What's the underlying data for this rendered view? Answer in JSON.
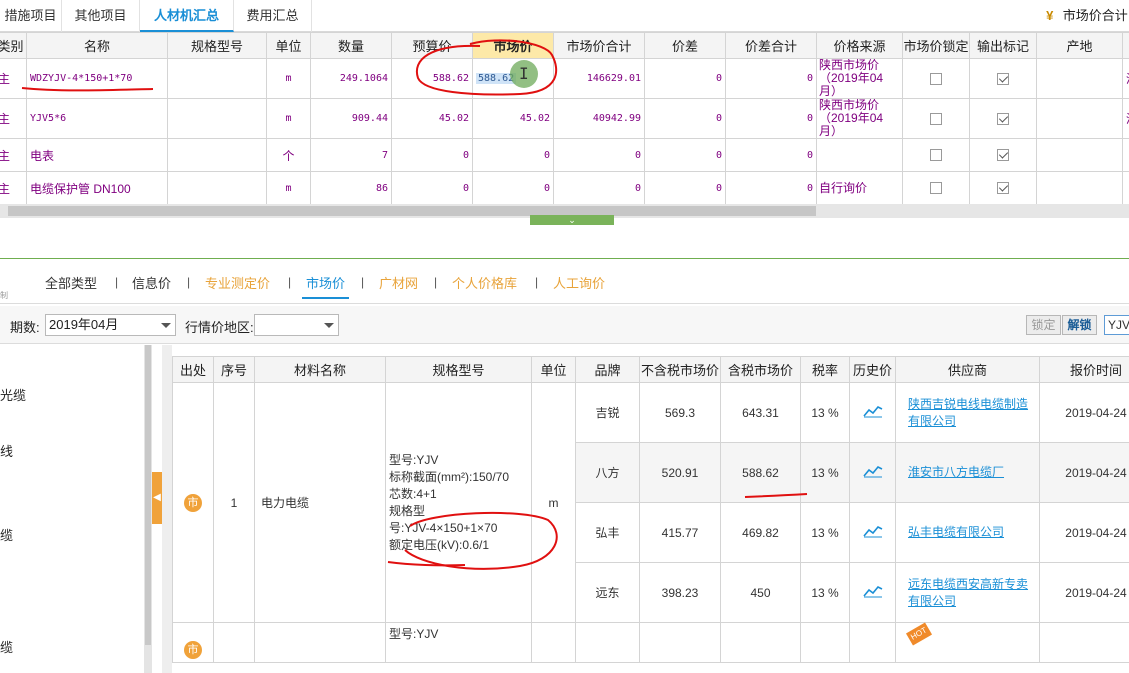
{
  "top_tabs": [
    {
      "label": "措施项目"
    },
    {
      "label": "其他项目"
    },
    {
      "label": "人材机汇总"
    },
    {
      "label": "费用汇总"
    }
  ],
  "summary_label": "市场价合计 :",
  "upper_headers": [
    "类别",
    "名称",
    "规格型号",
    "单位",
    "数量",
    "预算价",
    "市场价",
    "市场价合计",
    "价差",
    "价差合计",
    "价格来源",
    "市场价锁定",
    "输出标记",
    "产地"
  ],
  "upper_rows": [
    {
      "type": "主",
      "name": "WDZYJV-4*150+1*70",
      "spec": "",
      "unit": "m",
      "qty": "249.1064",
      "budget": "588.62",
      "market": "588.62",
      "total": "146629.01",
      "diff": "0",
      "diff_total": "0",
      "source": "陕西市场价（2019年04月）",
      "locked": false,
      "output": true,
      "origin": "",
      "extra": "淮纟"
    },
    {
      "type": "主",
      "name": "YJV5*6",
      "spec": "",
      "unit": "m",
      "qty": "909.44",
      "budget": "45.02",
      "market": "45.02",
      "total": "40942.99",
      "diff": "0",
      "diff_total": "0",
      "source": "陕西市场价（2019年04月）",
      "locked": false,
      "output": true,
      "origin": "",
      "extra": "淮纟"
    },
    {
      "type": "主",
      "name": "电表",
      "spec": "",
      "unit": "个",
      "qty": "7",
      "budget": "0",
      "market": "0",
      "total": "0",
      "diff": "0",
      "diff_total": "0",
      "source": "",
      "locked": false,
      "output": true,
      "origin": "",
      "extra": ""
    },
    {
      "type": "主",
      "name": "电缆保护管 DN100",
      "spec": "",
      "unit": "m",
      "qty": "86",
      "budget": "0",
      "market": "0",
      "total": "0",
      "diff": "0",
      "diff_total": "0",
      "source": "自行询价",
      "locked": false,
      "output": true,
      "origin": "",
      "extra": ""
    }
  ],
  "category_tabs": [
    {
      "label": "全部类型",
      "style": "normal"
    },
    {
      "label": "信息价",
      "style": "normal"
    },
    {
      "label": "专业测定价",
      "style": "orange"
    },
    {
      "label": "市场价",
      "style": "active"
    },
    {
      "label": "广材网",
      "style": "orange"
    },
    {
      "label": "个人价格库",
      "style": "orange"
    },
    {
      "label": "人工询价",
      "style": "orange"
    }
  ],
  "filter": {
    "period_label": "期数:",
    "period_value": "2019年04月",
    "region_label": "行情价地区:",
    "region_value": "",
    "lock_label": "锁定",
    "unlock_label": "解锁",
    "search_value": "YJV"
  },
  "left_tree": [
    "光缆",
    "线",
    "缆",
    "缆"
  ],
  "lower_headers": [
    "出处",
    "序号",
    "材料名称",
    "规格型号",
    "单位",
    "品牌",
    "不含税市场价",
    "含税市场价",
    "税率",
    "历史价",
    "供应商",
    "报价时间"
  ],
  "lower_group": {
    "badge": "市",
    "index": "1",
    "material": "电力电缆",
    "spec_lines": [
      "型号:YJV",
      "标称截面(mm²):150/70",
      "芯数:4+1",
      "规格型",
      "号:YJV-4×150+1×70",
      "额定电压(kV):0.6/1"
    ],
    "unit": "m",
    "rows": [
      {
        "brand": "吉锐",
        "price_ex": "569.3",
        "price_inc": "643.31",
        "tax": "13 %",
        "supplier": "陕西吉锐电线电缆制造有限公司",
        "time": "2019-04-24"
      },
      {
        "brand": "八方",
        "price_ex": "520.91",
        "price_inc": "588.62",
        "tax": "13 %",
        "supplier": "淮安市八方电缆厂",
        "time": "2019-04-24"
      },
      {
        "brand": "弘丰",
        "price_ex": "415.77",
        "price_inc": "469.82",
        "tax": "13 %",
        "supplier": "弘丰电缆有限公司",
        "time": "2019-04-24"
      },
      {
        "brand": "远东",
        "price_ex": "398.23",
        "price_inc": "450",
        "tax": "13 %",
        "supplier": "远东电缆西安高新专卖有限公司",
        "time": "2019-04-24"
      }
    ]
  },
  "lower_next_spec": "型号:YJV",
  "icons": {
    "summary": "yen-coin-icon",
    "history": "trend-chart-icon",
    "hot": "hot-tag-icon",
    "cursor": "text-cursor-icon"
  },
  "colors": {
    "accent": "#1a8fd6",
    "highlight_header": "#fde9a8",
    "orange": "#e8a33a",
    "annotation": "#e01010"
  }
}
